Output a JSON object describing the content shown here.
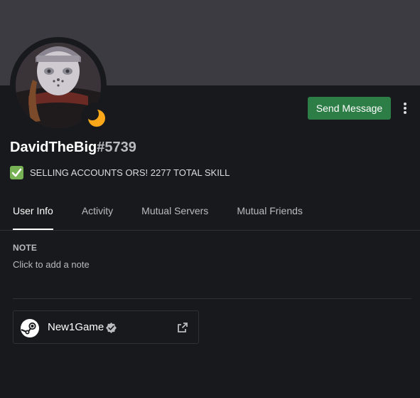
{
  "profile": {
    "username": "DavidTheBig",
    "discriminator": "#5739",
    "custom_status": "SELLING ACCOUNTS ORS! 2277 TOTAL SKILL",
    "status_emoji": "white-check-mark-icon",
    "presence": "idle",
    "presence_color": "#faa81a",
    "banner_color": "#3c3b41"
  },
  "actions": {
    "send_message_label": "Send Message",
    "send_message_color": "#2d7d46"
  },
  "tabs": [
    {
      "label": "User Info",
      "active": true
    },
    {
      "label": "Activity",
      "active": false
    },
    {
      "label": "Mutual Servers",
      "active": false
    },
    {
      "label": "Mutual Friends",
      "active": false
    }
  ],
  "note": {
    "title": "NOTE",
    "placeholder": "Click to add a note"
  },
  "connections": [
    {
      "platform": "steam",
      "icon": "steam-icon",
      "name": "New1Game",
      "verified": true
    }
  ]
}
